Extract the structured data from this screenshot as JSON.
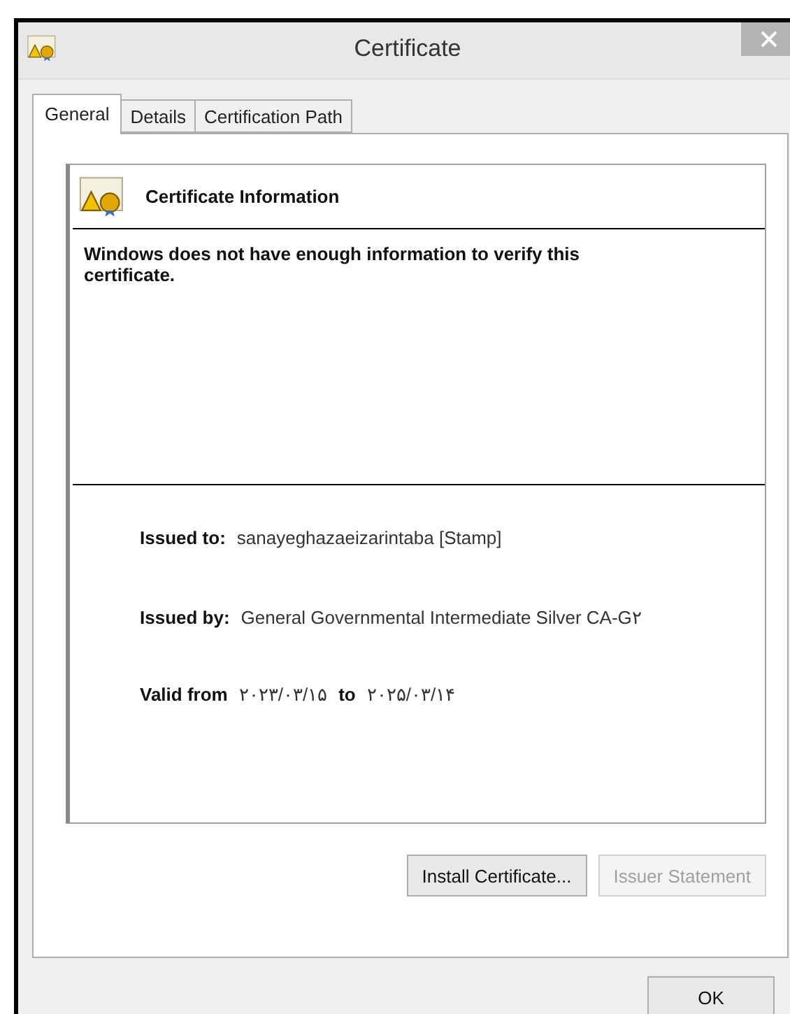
{
  "window": {
    "title": "Certificate"
  },
  "tabs": [
    {
      "label": "General",
      "selected": true
    },
    {
      "label": "Details",
      "selected": false
    },
    {
      "label": "Certification Path",
      "selected": false
    }
  ],
  "info": {
    "heading": "Certificate Information",
    "message": "Windows does not have enough information to verify this certificate."
  },
  "issued_to": {
    "label": "Issued to:",
    "value": "sanayeghazaeizarintaba [Stamp]"
  },
  "issued_by": {
    "label": "Issued by:",
    "value": "General Governmental Intermediate Silver CA-G۲"
  },
  "validity": {
    "label_from": "Valid from",
    "from": "۲۰۲۳/۰۳/۱۵",
    "label_to": "to",
    "to": "۲۰۲۵/۰۳/۱۴"
  },
  "panel_buttons": [
    {
      "label": "Install Certificate...",
      "disabled": false
    },
    {
      "label": "Issuer Statement",
      "disabled": true
    }
  ],
  "ok_button": {
    "label": "OK"
  }
}
